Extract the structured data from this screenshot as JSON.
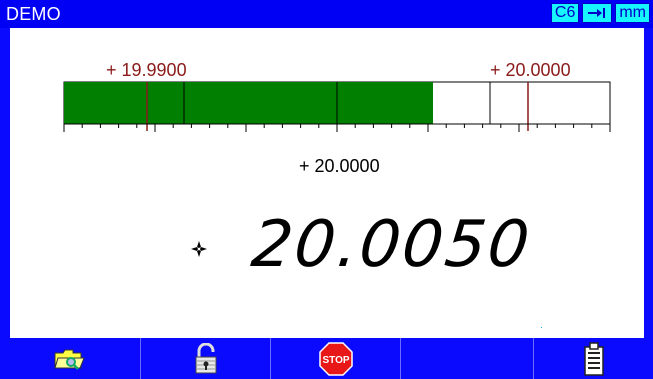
{
  "window": {
    "title": "DEMO"
  },
  "status_badges": [
    "C6",
    "→",
    "mm"
  ],
  "gauge": {
    "low_label": "+ 19.9900",
    "high_label": "+ 20.0000",
    "center_label": "+ 20.0000",
    "fill_fraction": 0.675,
    "colors": {
      "fill": "#007f00",
      "marker": "#8b1a1a",
      "frame": "#000000"
    }
  },
  "readout": {
    "value": "20.0050",
    "sign_icon": "plus-sign-icon"
  },
  "toolbar": {
    "buttons": [
      {
        "name": "open-file-button",
        "icon": "folder-search-icon"
      },
      {
        "name": "unlock-button",
        "icon": "unlocked-padlock-icon"
      },
      {
        "name": "stop-button",
        "icon": "stop-sign-icon",
        "label": "STOP"
      },
      {
        "name": "empty-button-4",
        "icon": ""
      },
      {
        "name": "empty-button-5",
        "icon": ""
      },
      {
        "name": "clipboard-button",
        "icon": "clipboard-icon"
      }
    ]
  }
}
